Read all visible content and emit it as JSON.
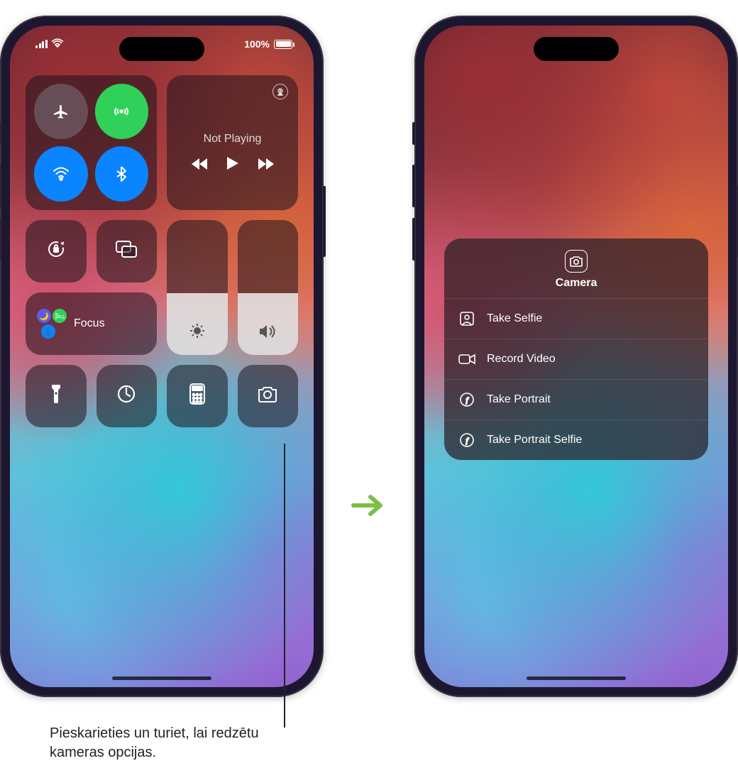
{
  "status": {
    "battery_text": "100%"
  },
  "connectivity": {
    "airplane": "airplane-icon",
    "cellular": "cellular-icon",
    "wifi": "wifi-icon",
    "bluetooth": "bluetooth-icon"
  },
  "media": {
    "title": "Not Playing",
    "prev": "back-icon",
    "play": "play-icon",
    "next": "forward-icon",
    "airplay": "airplay-icon"
  },
  "controls": {
    "orientation_lock": "orientation-lock-icon",
    "screen_mirroring": "screen-mirroring-icon",
    "focus_label": "Focus",
    "brightness": "brightness-icon",
    "volume": "volume-icon"
  },
  "bottom_row": {
    "flashlight": "flashlight-icon",
    "timer": "timer-icon",
    "calculator": "calculator-icon",
    "camera": "camera-icon"
  },
  "camera_menu": {
    "title": "Camera",
    "items": [
      {
        "icon": "selfie-icon",
        "label": "Take Selfie"
      },
      {
        "icon": "video-icon",
        "label": "Record Video"
      },
      {
        "icon": "portrait-icon",
        "label": "Take Portrait"
      },
      {
        "icon": "portrait-selfie-icon",
        "label": "Take Portrait Selfie"
      }
    ]
  },
  "caption": "Pieskarieties un turiet, lai redzētu kameras opcijas."
}
